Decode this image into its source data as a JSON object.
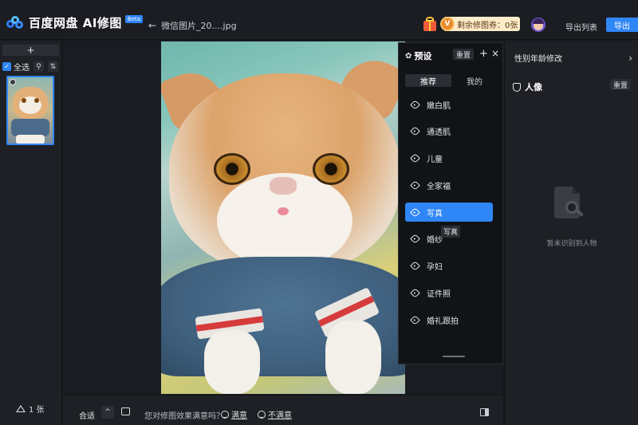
{
  "header": {
    "app_name": "百度网盘 AI修图",
    "beta_badge": "Beta",
    "back_file": "微信图片_20....jpg",
    "coupon_badge": "V",
    "coupon_text": "剩余修图券：0张",
    "export_list": "导出列表",
    "export": "导出"
  },
  "sidebar": {
    "add": "+",
    "select_all": "全选",
    "filter_icon": "filter-icon",
    "sort_icon": "sort-icon",
    "count": "1 张"
  },
  "preset_panel": {
    "title": "预设",
    "reset": "重置",
    "add": "+",
    "close": "×",
    "tabs": [
      {
        "label": "推荐",
        "active": true
      },
      {
        "label": "我的",
        "active": false
      }
    ],
    "items": [
      {
        "label": "嫩白肌",
        "active": false
      },
      {
        "label": "通透肌",
        "active": false
      },
      {
        "label": "儿童",
        "active": false
      },
      {
        "label": "全家福",
        "active": false
      },
      {
        "label": "写真",
        "active": true
      },
      {
        "label": "婚纱",
        "active": false
      },
      {
        "label": "孕妇",
        "active": false
      },
      {
        "label": "证件照",
        "active": false
      },
      {
        "label": "婚礼跟拍",
        "active": false
      }
    ],
    "tooltip": "写真"
  },
  "right_panel": {
    "gender_age": "性别年龄修改",
    "person_title": "人像",
    "person_reset": "重置",
    "empty_text": "暂未识别到人物"
  },
  "bottom": {
    "fit": "合适",
    "fit_toggle": "^",
    "question": "您对修图效果满意吗？",
    "satisfied": "满意",
    "unsatisfied": "不满意"
  },
  "colors": {
    "accent": "#2f86f6",
    "background": "#16181d",
    "panel": "#1e2025"
  }
}
